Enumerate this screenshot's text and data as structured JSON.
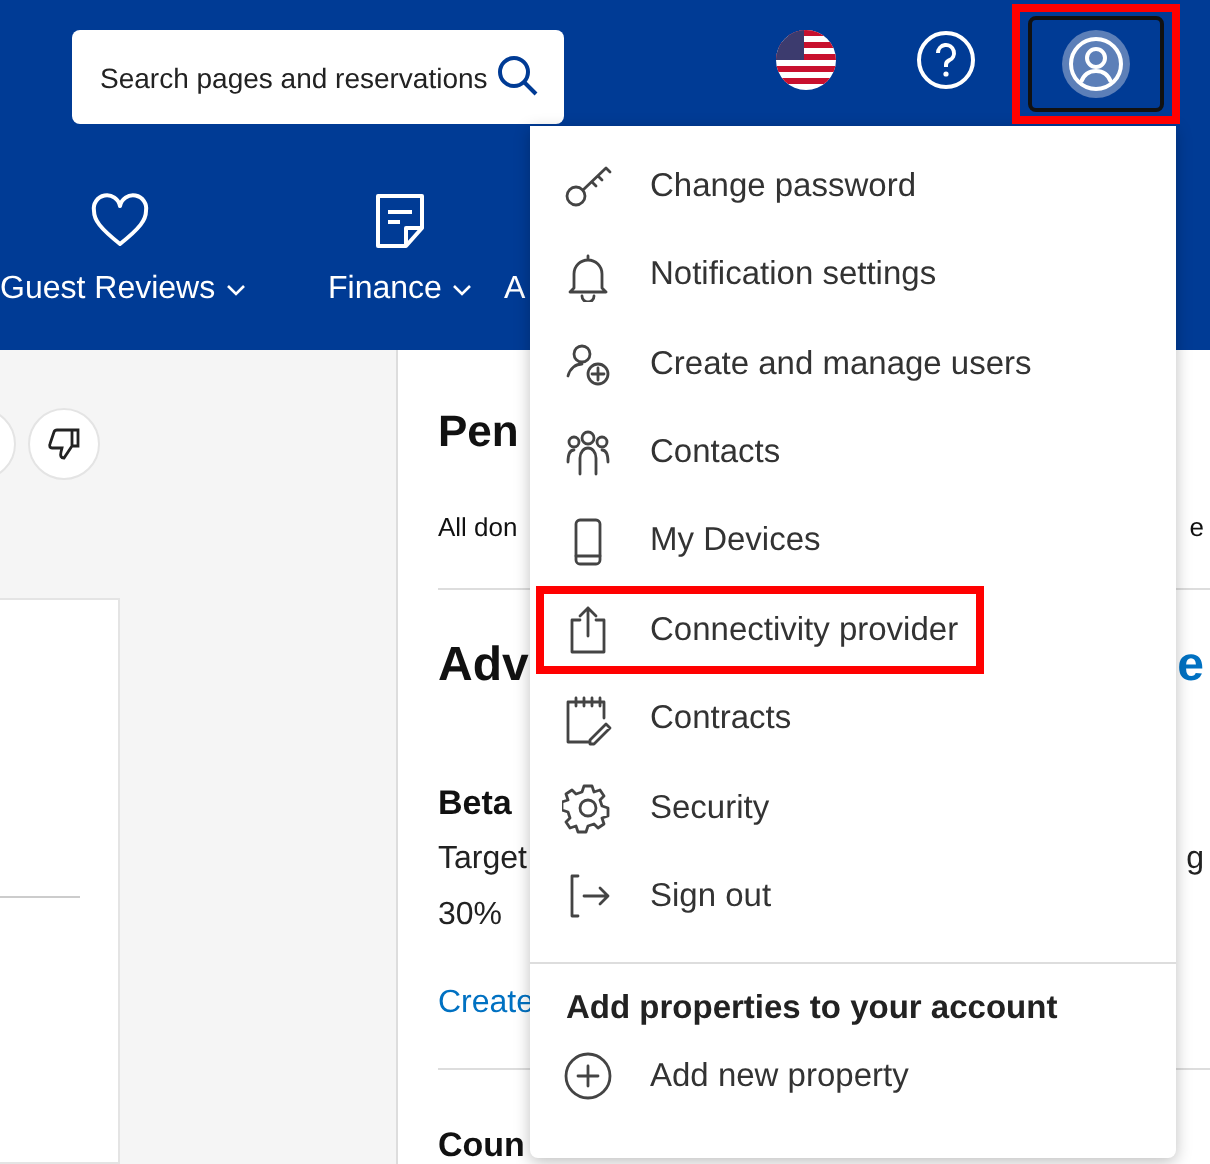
{
  "header": {
    "search": {
      "placeholder": "Search pages and reservations"
    },
    "account_button": {
      "highlighted": true
    }
  },
  "nav": [
    {
      "label": "Guest Reviews",
      "caret": true
    },
    {
      "label": "Finance",
      "caret": true
    },
    {
      "label": "A",
      "caret": false
    }
  ],
  "panel": [
    {
      "kind": "title",
      "text": "Pen"
    },
    {
      "kind": "small",
      "text": "All don",
      "trailing": "e"
    },
    {
      "kind": "divider"
    },
    {
      "kind": "heading",
      "text": "Adv",
      "trailing_link": "e"
    },
    {
      "kind": "subheading",
      "text": "Beta"
    },
    {
      "kind": "body",
      "text": "Target",
      "trailing": "g"
    },
    {
      "kind": "body",
      "text": "30%"
    },
    {
      "kind": "link",
      "text": "Create"
    },
    {
      "kind": "divider"
    },
    {
      "kind": "subheading",
      "text": "Coun"
    }
  ],
  "account_menu": {
    "items": [
      {
        "label": "Change password",
        "highlighted": false
      },
      {
        "label": "Notification settings",
        "highlighted": false
      },
      {
        "label": "Create and manage users",
        "highlighted": false
      },
      {
        "label": "Contacts",
        "highlighted": false
      },
      {
        "label": "My Devices",
        "highlighted": false
      },
      {
        "label": "Connectivity provider",
        "highlighted": true
      },
      {
        "label": "Contracts",
        "highlighted": false
      },
      {
        "label": "Security",
        "highlighted": false
      },
      {
        "label": "Sign out",
        "highlighted": false
      }
    ],
    "section_title": "Add properties to your account",
    "add_item": {
      "label": "Add new property"
    }
  }
}
